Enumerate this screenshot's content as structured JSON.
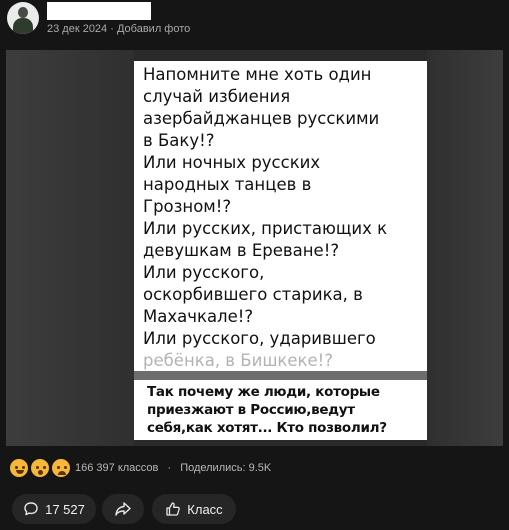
{
  "post": {
    "date": "23 дек 2024",
    "separator": "·",
    "action": "Добавил фото"
  },
  "image_text": {
    "main_lines": [
      "Напомните мне хоть один",
      "случай избиения",
      "азербайджанцев русскими",
      "в Баку!?",
      "Или ночных русских",
      "народных танцев в",
      "Грозном!?",
      "Или русских, пристающих к",
      "девушкам в Ереване!?",
      "Или русского,",
      "оскорбившего старика, в",
      "Махачкале!?",
      "Или русского, ударившего",
      "ребёнка, в Бишкеке!?"
    ],
    "bold_lines": [
      "Так почему же люди, которые",
      "приезжают в Россию,ведут",
      "себя,как хотят... Кто позволил?"
    ]
  },
  "stats": {
    "classes": "166 397 классов",
    "dot": "·",
    "shared": "Поделились: 9.5K"
  },
  "actions": {
    "comments_count": "17 527",
    "like_label": "Класс"
  },
  "icons": {
    "comment": "comment-bubble-icon",
    "share": "share-arrow-icon",
    "like": "thumbs-up-icon"
  }
}
